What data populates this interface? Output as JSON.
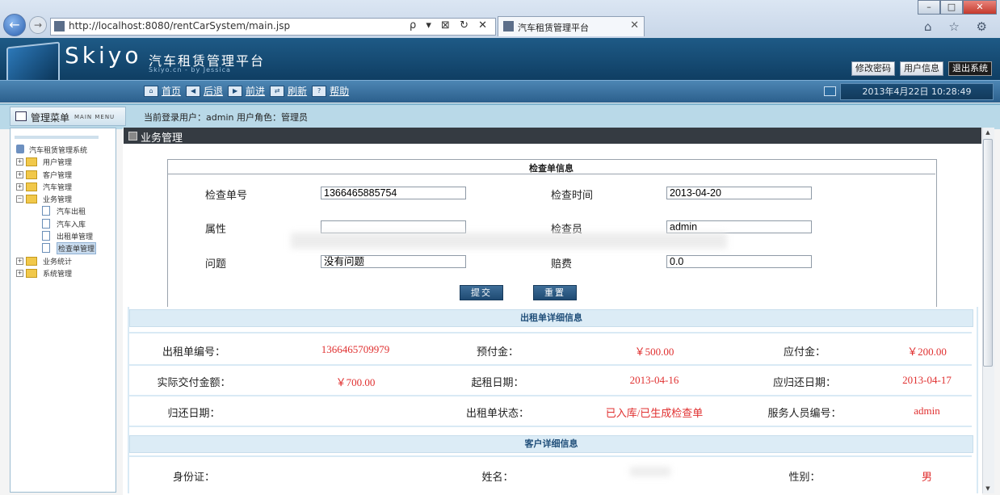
{
  "browser": {
    "url": "http://localhost:8080/rentCarSystem/main.jsp",
    "tab_title": "汽车租赁管理平台",
    "address_controls": "ρ ▾ ⊠ ↻ ✕",
    "tab_close": "✕",
    "window_controls": [
      "–",
      "□",
      "✕"
    ],
    "toolbar_icons": "⌂ ☆ ⚙",
    "back_glyph": "←",
    "forward_glyph": "→"
  },
  "app": {
    "logo": "Skiyo",
    "title": "汽车租赁管理平台",
    "subtitle": "Skiyo.cn - by Jessica",
    "top_actions": [
      "修改密码",
      "用户信息",
      "退出系统"
    ],
    "nav": [
      "首页",
      "后退",
      "前进",
      "刷新",
      "帮助"
    ],
    "datetime": "2013年4月22日  10:28:49"
  },
  "menu": {
    "title": "管理菜单",
    "title_en": "MAIN MENU",
    "login_info": "当前登录用户：admin  用户角色：管理员"
  },
  "tree": [
    {
      "label": "汽车租赁管理系统",
      "level": 0,
      "kind": "root"
    },
    {
      "label": "用户管理",
      "level": 1,
      "kind": "folder",
      "toggle": "+"
    },
    {
      "label": "客户管理",
      "level": 1,
      "kind": "folder",
      "toggle": "+"
    },
    {
      "label": "汽车管理",
      "level": 1,
      "kind": "folder",
      "toggle": "+"
    },
    {
      "label": "业务管理",
      "level": 1,
      "kind": "folder",
      "toggle": "−"
    },
    {
      "label": "汽车出租",
      "level": 2,
      "kind": "doc"
    },
    {
      "label": "汽车入库",
      "level": 2,
      "kind": "doc"
    },
    {
      "label": "出租单管理",
      "level": 2,
      "kind": "doc"
    },
    {
      "label": "检查单管理",
      "level": 2,
      "kind": "doc",
      "selected": true
    },
    {
      "label": "业务统计",
      "level": 1,
      "kind": "folder",
      "toggle": "+"
    },
    {
      "label": "系统管理",
      "level": 1,
      "kind": "folder",
      "toggle": "+"
    }
  ],
  "section_title": "业务管理",
  "check_form": {
    "title": "检查单信息",
    "fields": {
      "check_no": {
        "label": "检查单号",
        "value": "1366465885754"
      },
      "check_time": {
        "label": "检查时间",
        "value": "2013-04-20"
      },
      "attribute": {
        "label": "属性",
        "value": ""
      },
      "inspector": {
        "label": "检查员",
        "value": "admin"
      },
      "problem": {
        "label": "问题",
        "value": "没有问题"
      },
      "fee": {
        "label": "赔费",
        "value": "0.0"
      }
    },
    "submit": "提交",
    "reset": "重置"
  },
  "rental_detail": {
    "header": "出租单详细信息",
    "rows": [
      [
        {
          "label": "出租单编号：",
          "value": "1366465709979"
        },
        {
          "label": "预付金：",
          "value": "￥500.00"
        },
        {
          "label": "应付金：",
          "value": "￥200.00"
        }
      ],
      [
        {
          "label": "实际交付金额：",
          "value": "￥700.00"
        },
        {
          "label": "起租日期：",
          "value": "2013-04-16"
        },
        {
          "label": "应归还日期：",
          "value": "2013-04-17"
        }
      ],
      [
        {
          "label": "归还日期：",
          "value": ""
        },
        {
          "label": "出租单状态：",
          "value": "已入库/已生成检查单"
        },
        {
          "label": "服务人员编号：",
          "value": "admin"
        }
      ]
    ]
  },
  "customer_detail": {
    "header": "客户详细信息",
    "rows": [
      [
        {
          "label": "身份证：",
          "value": ""
        },
        {
          "label": "姓名：",
          "value": ""
        },
        {
          "label": "性别：",
          "value": "男"
        }
      ]
    ]
  },
  "colors": {
    "header_bg": "#1e5a86",
    "nav_bg": "#3a73a3",
    "value_red": "#e03030",
    "section_dark": "#353b42"
  }
}
